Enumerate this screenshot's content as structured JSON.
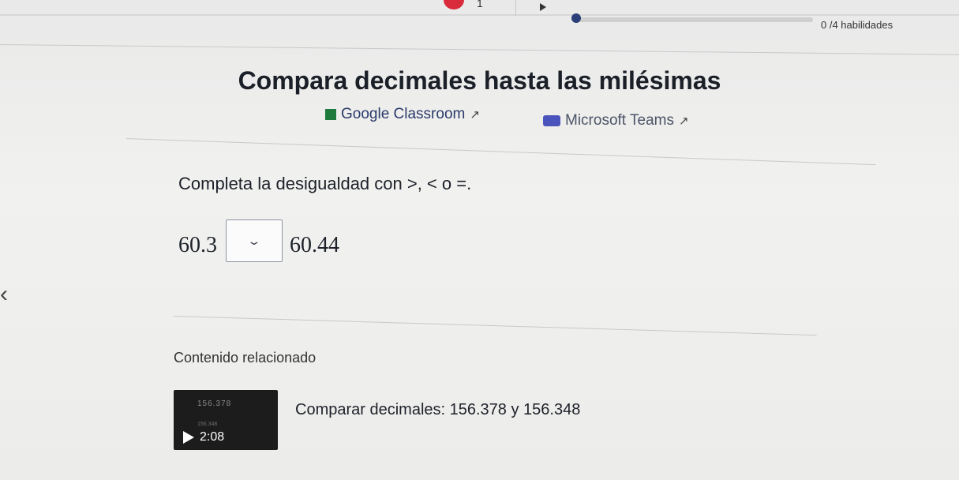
{
  "top": {
    "step_number": "1",
    "skills_text": "0 /4 habilidades"
  },
  "exercise": {
    "title": "Compara decimales hasta las milésimas",
    "share": {
      "classroom": "Google Classroom",
      "teams": "Microsoft Teams"
    },
    "instruction": "Completa la desigualdad con >, < o =.",
    "left_value": "60.3",
    "right_value": "60.44",
    "dropdown_value": "",
    "dropdown_chevron": "⌄"
  },
  "related": {
    "heading": "Contenido relacionado",
    "video": {
      "thumbnail_text": "156.378",
      "thumbnail_subtext": "156.348",
      "duration": "2:08",
      "title": "Comparar decimales: 156.378 y 156.348"
    }
  },
  "nav": {
    "back_chevron": "‹"
  },
  "colors": {
    "accent": "#2b3f78",
    "streak_red": "#d92a3b",
    "classroom_green": "#1f7a3d",
    "teams_purple": "#4b53bc"
  },
  "icons": [
    "play-icon",
    "google-classroom-icon",
    "microsoft-teams-icon",
    "external-link-icon",
    "chevron-down-icon",
    "chevron-left-icon"
  ]
}
